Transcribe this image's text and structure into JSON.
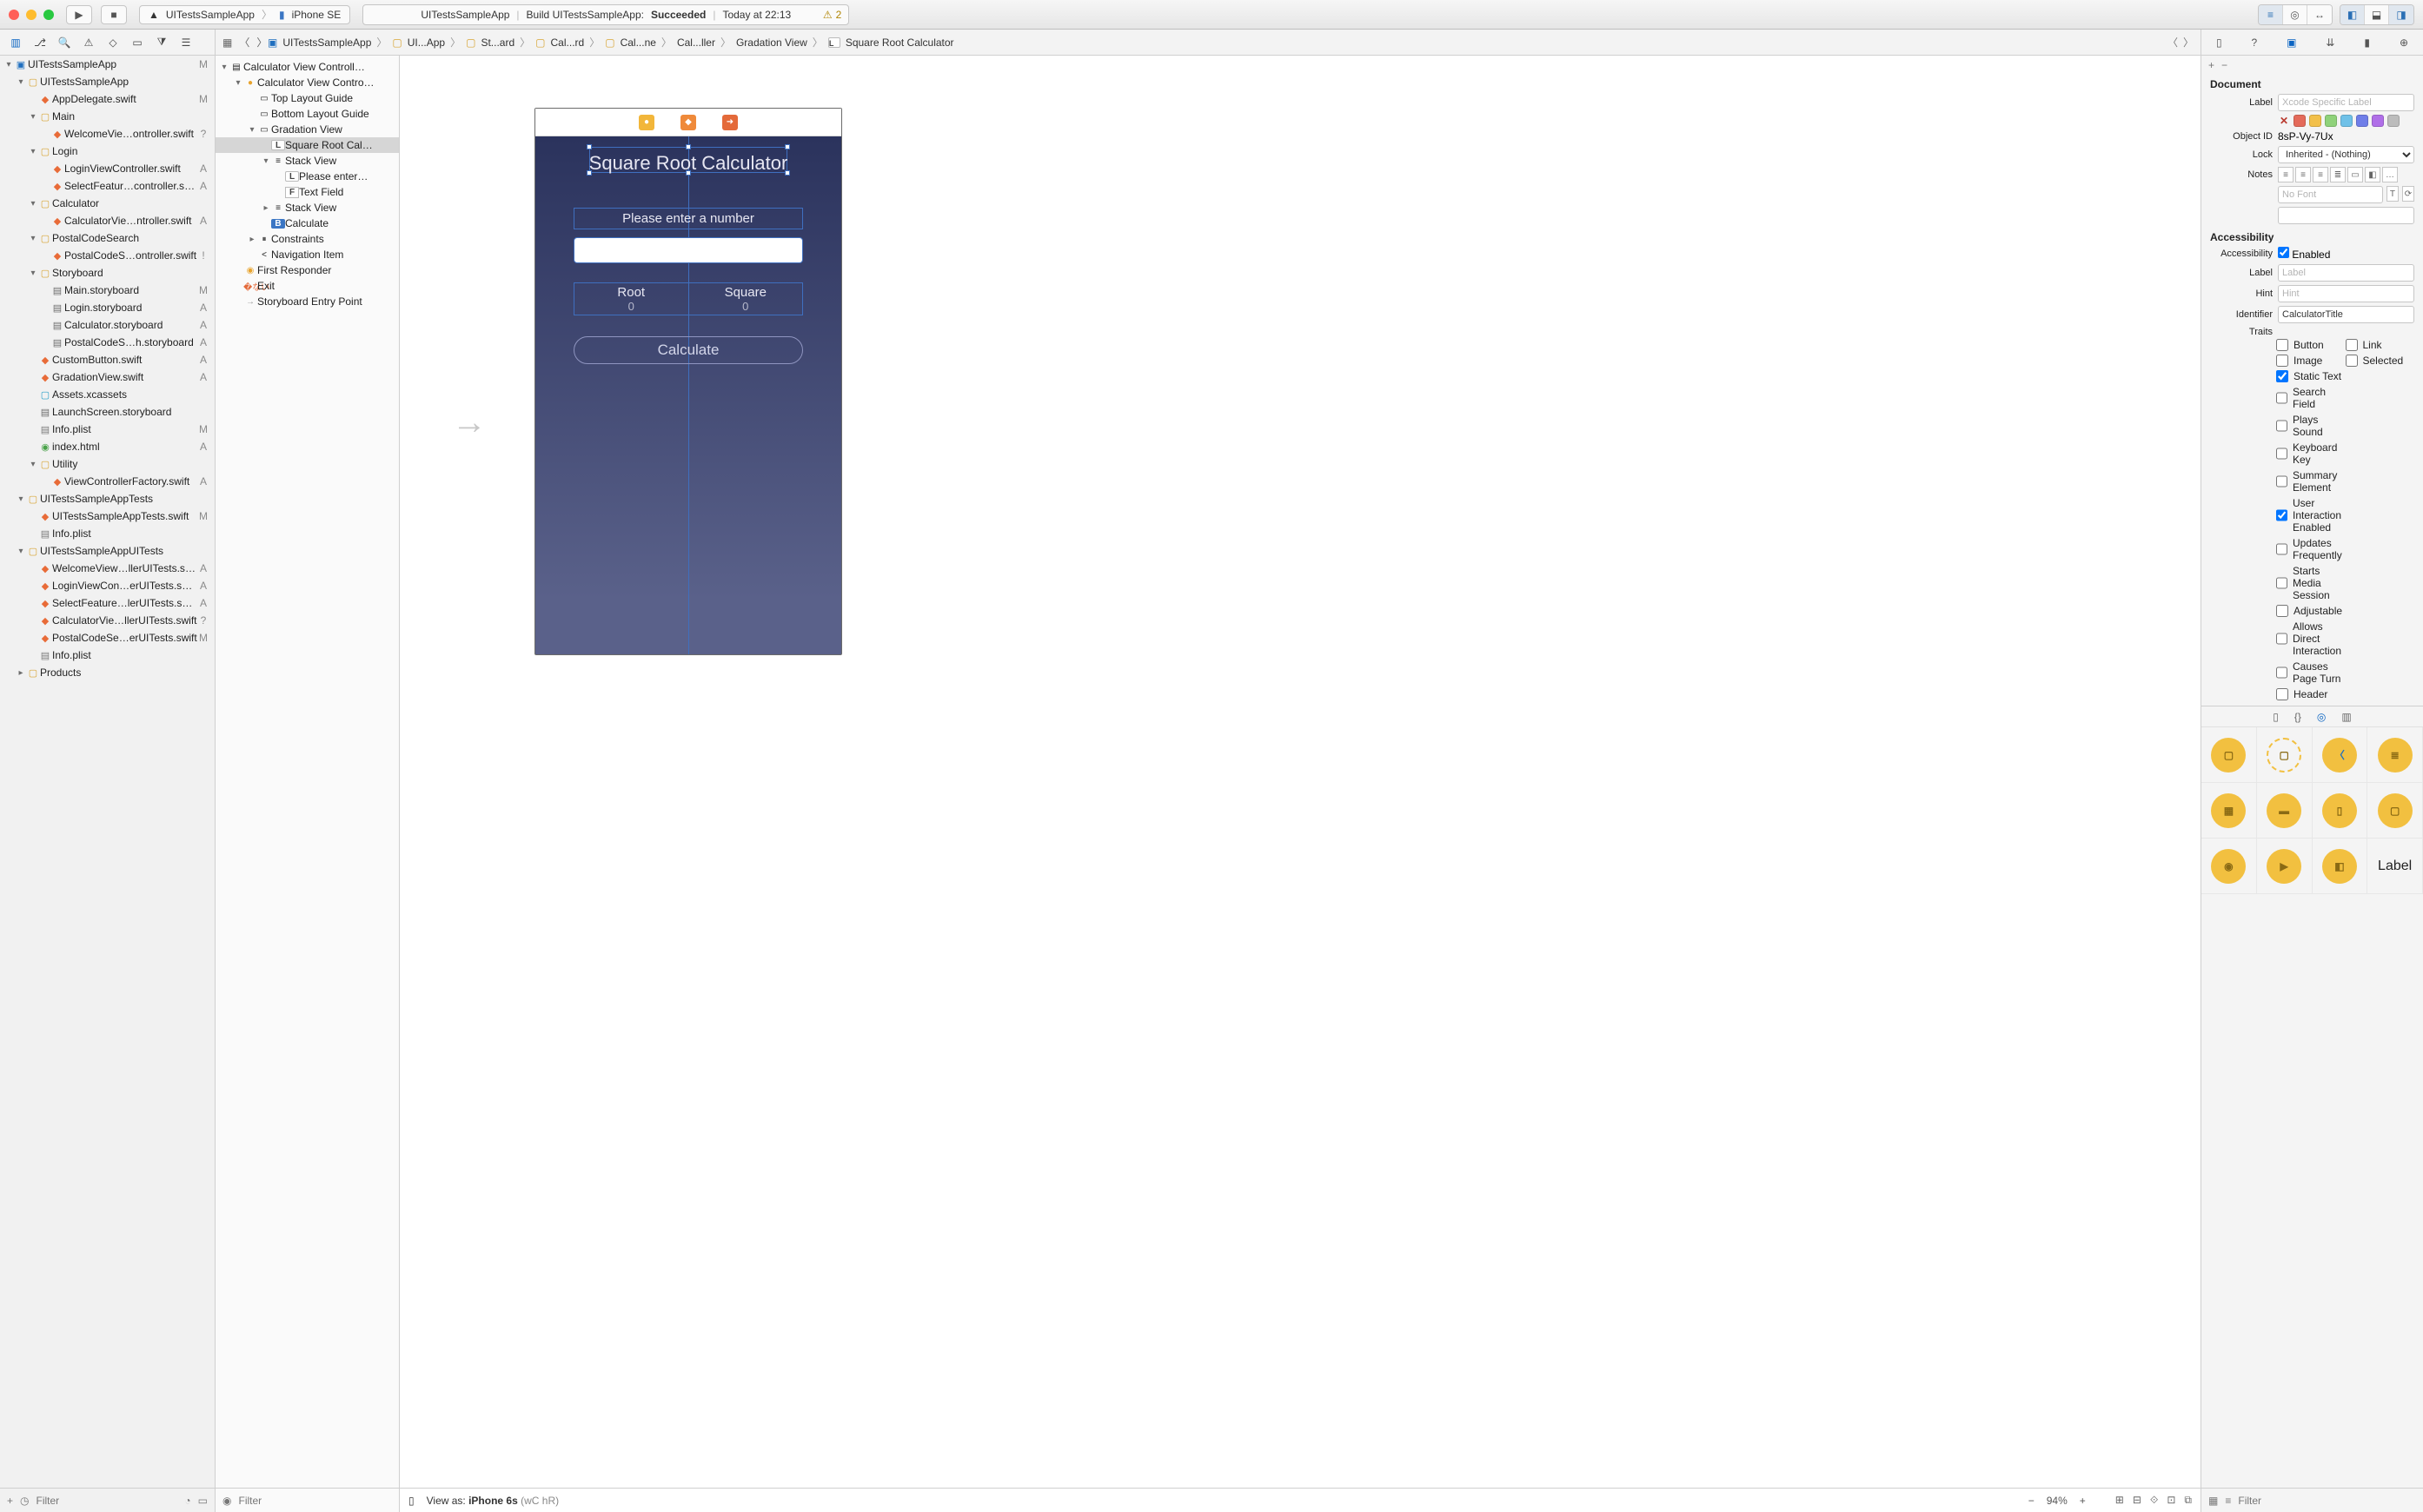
{
  "titlebar": {
    "traffic": [
      "#ff5f57",
      "#febc2e",
      "#28c840"
    ],
    "scheme_app": "UITestsSampleApp",
    "scheme_device": "iPhone SE",
    "status_app": "UITestsSampleApp",
    "status_action": "Build UITestsSampleApp:",
    "status_result": "Succeeded",
    "status_time": "Today at 22:13",
    "warn_count": "2"
  },
  "crumbs": [
    "UITestsSampleApp",
    "UI...App",
    "St...ard",
    "Cal...rd",
    "Cal...ne",
    "Cal...ller",
    "Gradation View",
    "Square Root Calculator"
  ],
  "navigator": [
    {
      "i": 0,
      "d": "▾",
      "k": "proj",
      "n": "UITestsSampleApp",
      "b": "M"
    },
    {
      "i": 1,
      "d": "▾",
      "k": "fold-y",
      "n": "UITestsSampleApp",
      "b": ""
    },
    {
      "i": 2,
      "d": "",
      "k": "swift",
      "n": "AppDelegate.swift",
      "b": "M"
    },
    {
      "i": 2,
      "d": "▾",
      "k": "fold-y",
      "n": "Main",
      "b": ""
    },
    {
      "i": 3,
      "d": "",
      "k": "swift",
      "n": "WelcomeVie…ontroller.swift",
      "b": "?"
    },
    {
      "i": 2,
      "d": "▾",
      "k": "fold-y",
      "n": "Login",
      "b": ""
    },
    {
      "i": 3,
      "d": "",
      "k": "swift",
      "n": "LoginViewController.swift",
      "b": "A"
    },
    {
      "i": 3,
      "d": "",
      "k": "swift",
      "n": "SelectFeatur…controller.swift",
      "b": "A"
    },
    {
      "i": 2,
      "d": "▾",
      "k": "fold-y",
      "n": "Calculator",
      "b": ""
    },
    {
      "i": 3,
      "d": "",
      "k": "swift",
      "n": "CalculatorVie…ntroller.swift",
      "b": "A"
    },
    {
      "i": 2,
      "d": "▾",
      "k": "fold-y",
      "n": "PostalCodeSearch",
      "b": ""
    },
    {
      "i": 3,
      "d": "",
      "k": "swift",
      "n": "PostalCodeS…ontroller.swift",
      "b": "!"
    },
    {
      "i": 2,
      "d": "▾",
      "k": "fold-y",
      "n": "Storyboard",
      "b": ""
    },
    {
      "i": 3,
      "d": "",
      "k": "sb",
      "n": "Main.storyboard",
      "b": "M"
    },
    {
      "i": 3,
      "d": "",
      "k": "sb",
      "n": "Login.storyboard",
      "b": "A"
    },
    {
      "i": 3,
      "d": "",
      "k": "sb",
      "n": "Calculator.storyboard",
      "b": "A"
    },
    {
      "i": 3,
      "d": "",
      "k": "sb",
      "n": "PostalCodeS…h.storyboard",
      "b": "A"
    },
    {
      "i": 2,
      "d": "",
      "k": "swift",
      "n": "CustomButton.swift",
      "b": "A"
    },
    {
      "i": 2,
      "d": "",
      "k": "swift",
      "n": "GradationView.swift",
      "b": "A"
    },
    {
      "i": 2,
      "d": "",
      "k": "asset",
      "n": "Assets.xcassets",
      "b": ""
    },
    {
      "i": 2,
      "d": "",
      "k": "sb",
      "n": "LaunchScreen.storyboard",
      "b": ""
    },
    {
      "i": 2,
      "d": "",
      "k": "plist",
      "n": "Info.plist",
      "b": "M"
    },
    {
      "i": 2,
      "d": "",
      "k": "html",
      "n": "index.html",
      "b": "A"
    },
    {
      "i": 2,
      "d": "▾",
      "k": "fold-y",
      "n": "Utility",
      "b": ""
    },
    {
      "i": 3,
      "d": "",
      "k": "swift",
      "n": "ViewControllerFactory.swift",
      "b": "A"
    },
    {
      "i": 1,
      "d": "▾",
      "k": "fold-y",
      "n": "UITestsSampleAppTests",
      "b": ""
    },
    {
      "i": 2,
      "d": "",
      "k": "swift",
      "n": "UITestsSampleAppTests.swift",
      "b": "M"
    },
    {
      "i": 2,
      "d": "",
      "k": "plist",
      "n": "Info.plist",
      "b": ""
    },
    {
      "i": 1,
      "d": "▾",
      "k": "fold-y",
      "n": "UITestsSampleAppUITests",
      "b": ""
    },
    {
      "i": 2,
      "d": "",
      "k": "swift",
      "n": "WelcomeView…llerUITests.swift",
      "b": "A"
    },
    {
      "i": 2,
      "d": "",
      "k": "swift",
      "n": "LoginViewCon…erUITests.swift",
      "b": "A"
    },
    {
      "i": 2,
      "d": "",
      "k": "swift",
      "n": "SelectFeature…lerUITests.swift",
      "b": "A"
    },
    {
      "i": 2,
      "d": "",
      "k": "swift",
      "n": "CalculatorVie…llerUITests.swift",
      "b": "?"
    },
    {
      "i": 2,
      "d": "",
      "k": "swift",
      "n": "PostalCodeSe…erUITests.swift",
      "b": "M"
    },
    {
      "i": 2,
      "d": "",
      "k": "plist",
      "n": "Info.plist",
      "b": ""
    },
    {
      "i": 1,
      "d": "▸",
      "k": "fold-y",
      "n": "Products",
      "b": ""
    }
  ],
  "outline": [
    {
      "i": 0,
      "d": "▾",
      "ic": "▤",
      "cls": "",
      "n": "Calculator View Controll…"
    },
    {
      "i": 1,
      "d": "▾",
      "ic": "●",
      "cls": "vc-ic",
      "n": "Calculator View Contro…"
    },
    {
      "i": 2,
      "d": "",
      "ic": "▭",
      "cls": "",
      "n": "Top Layout Guide"
    },
    {
      "i": 2,
      "d": "",
      "ic": "▭",
      "cls": "",
      "n": "Bottom Layout Guide"
    },
    {
      "i": 2,
      "d": "▾",
      "ic": "▭",
      "cls": "",
      "n": "Gradation View"
    },
    {
      "i": 3,
      "d": "",
      "ic": "L",
      "cls": "lbl-ic",
      "n": "Square Root Cal…",
      "sel": true
    },
    {
      "i": 3,
      "d": "▾",
      "ic": "≡",
      "cls": "",
      "n": "Stack View"
    },
    {
      "i": 4,
      "d": "",
      "ic": "L",
      "cls": "lbl-ic",
      "n": "Please enter…"
    },
    {
      "i": 4,
      "d": "",
      "ic": "F",
      "cls": "fld-ic",
      "n": "Text Field"
    },
    {
      "i": 3,
      "d": "▸",
      "ic": "≡",
      "cls": "",
      "n": "Stack View"
    },
    {
      "i": 3,
      "d": "",
      "ic": "B",
      "cls": "calc-ic",
      "n": "Calculate"
    },
    {
      "i": 2,
      "d": "▸",
      "ic": "⏸",
      "cls": "",
      "n": "Constraints"
    },
    {
      "i": 2,
      "d": "",
      "ic": "<",
      "cls": "",
      "n": "Navigation Item"
    },
    {
      "i": 1,
      "d": "",
      "ic": "◉",
      "cls": "resp-ic",
      "n": "First Responder"
    },
    {
      "i": 1,
      "d": "",
      "ic": "�ない",
      "cls": "exit-ic",
      "n": "Exit"
    },
    {
      "i": 1,
      "d": "",
      "ic": "→",
      "cls": "arrow-ic",
      "n": "Storyboard Entry Point"
    }
  ],
  "device": {
    "title": "Square Root Calculator",
    "prompt": "Please enter a number",
    "root_hd": "Root",
    "root_v": "0",
    "square_hd": "Square",
    "square_v": "0",
    "calc": "Calculate"
  },
  "inspector": {
    "sec1": "Document",
    "label_ph": "Xcode Specific Label",
    "colors": [
      "#e46a5a",
      "#f2c04a",
      "#8fd27a",
      "#6fc1e8",
      "#6f7ee8",
      "#b06fe8",
      "#bcbcbc"
    ],
    "object_id_lbl": "Object ID",
    "object_id": "8sP-Vy-7Ux",
    "lock_lbl": "Lock",
    "lock_val": "Inherited - (Nothing)",
    "notes_lbl": "Notes",
    "font_ph": "No Font",
    "sec2": "Accessibility",
    "acc_lbl": "Accessibility",
    "acc_enabled": "Enabled",
    "a_label_lbl": "Label",
    "a_label_ph": "Label",
    "a_hint_lbl": "Hint",
    "a_hint_ph": "Hint",
    "a_ident_lbl": "Identifier",
    "a_ident": "CalculatorTitle",
    "traits_lbl": "Traits",
    "traits": [
      {
        "n": "Button",
        "c": false
      },
      {
        "n": "Link",
        "c": false
      },
      {
        "n": "Image",
        "c": false
      },
      {
        "n": "Selected",
        "c": false
      },
      {
        "n": "Static Text",
        "c": true
      },
      {
        "n": "",
        "c": false,
        "hide": true
      },
      {
        "n": "Search Field",
        "c": false
      },
      {
        "n": "",
        "c": false,
        "hide": true
      },
      {
        "n": "Plays Sound",
        "c": false
      },
      {
        "n": "",
        "c": false,
        "hide": true
      },
      {
        "n": "Keyboard Key",
        "c": false
      },
      {
        "n": "",
        "c": false,
        "hide": true
      },
      {
        "n": "Summary Element",
        "c": false
      },
      {
        "n": "",
        "c": false,
        "hide": true
      },
      {
        "n": "User Interaction Enabled",
        "c": true
      },
      {
        "n": "",
        "c": false,
        "hide": true
      },
      {
        "n": "Updates Frequently",
        "c": false
      },
      {
        "n": "",
        "c": false,
        "hide": true
      },
      {
        "n": "Starts Media Session",
        "c": false
      },
      {
        "n": "",
        "c": false,
        "hide": true
      },
      {
        "n": "Adjustable",
        "c": false
      },
      {
        "n": "",
        "c": false,
        "hide": true
      },
      {
        "n": "Allows Direct Interaction",
        "c": false
      },
      {
        "n": "",
        "c": false,
        "hide": true
      },
      {
        "n": "Causes Page Turn",
        "c": false
      },
      {
        "n": "",
        "c": false,
        "hide": true
      },
      {
        "n": "Header",
        "c": false
      },
      {
        "n": "",
        "c": false,
        "hide": true
      }
    ]
  },
  "objlib": {
    "label_text": "Label"
  },
  "bottom": {
    "nav_filter_ph": "Filter",
    "ol_filter_ph": "Filter",
    "viewas_pre": "View as:",
    "viewas": "iPhone 6s",
    "viewas_suf": "(wC hR)",
    "zoom": "94%",
    "lib_filter_ph": "Filter"
  }
}
